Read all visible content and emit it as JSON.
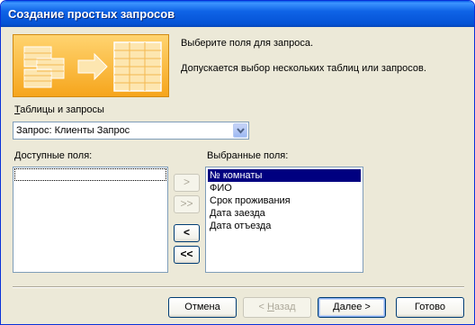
{
  "window": {
    "title": "Создание простых запросов"
  },
  "intro": {
    "line1": "Выберите поля для запроса.",
    "line2": "Допускается выбор нескольких таблиц или запросов."
  },
  "source": {
    "label_u": "Т",
    "label_rest": "аблицы и запросы",
    "value": "Запрос: Клиенты Запрос"
  },
  "available": {
    "label_u": "Д",
    "label_rest": "оступные поля:",
    "items": []
  },
  "selected": {
    "label": "Выбранные поля:",
    "items": [
      "№ комнаты",
      "ФИО",
      "Срок проживания",
      "Дата заезда",
      "Дата отъезда"
    ]
  },
  "transfer": {
    "add_one": ">",
    "add_all": ">>",
    "remove_one": "<",
    "remove_all": "<<"
  },
  "buttons": {
    "cancel": "Отмена",
    "back_prefix": "< ",
    "back_u": "Н",
    "back_rest": "азад",
    "next_u": "Д",
    "next_rest": "алее >",
    "finish": "Готово"
  },
  "colors": {
    "titlebar": "#0553d6",
    "selection": "#000080",
    "banner": "#f6a51c"
  }
}
